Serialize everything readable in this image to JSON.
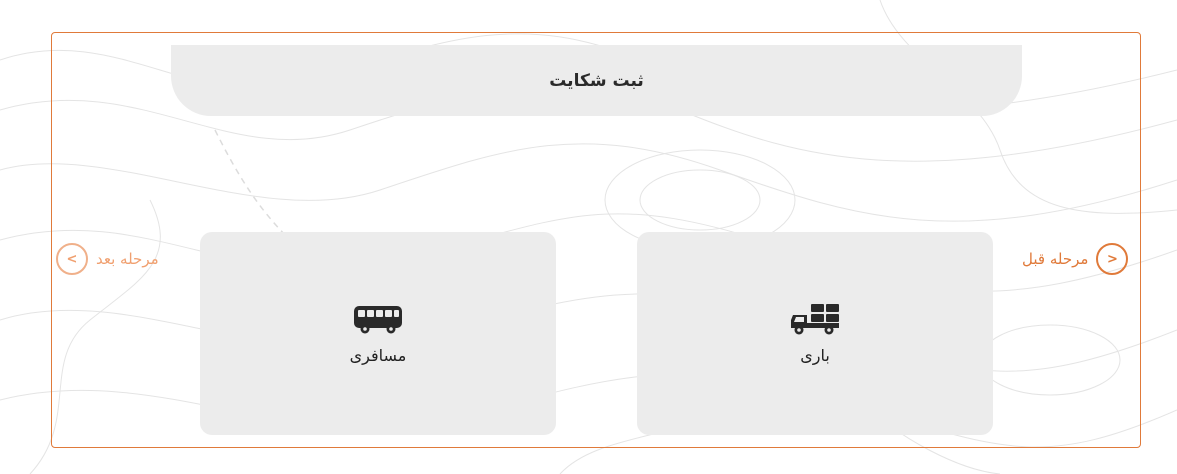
{
  "header": {
    "title": "ثبت شکایت"
  },
  "nav": {
    "prev": {
      "label": "مرحله قبل",
      "arrow": "<"
    },
    "next": {
      "label": "مرحله بعد",
      "arrow": ">"
    }
  },
  "options": {
    "cargo": {
      "label": "باری",
      "icon": "truck-icon"
    },
    "passenger": {
      "label": "مسافری",
      "icon": "bus-icon"
    }
  },
  "colors": {
    "accent": "#e07a3a",
    "accent_muted": "#f0a070",
    "card_bg": "#ececec"
  }
}
